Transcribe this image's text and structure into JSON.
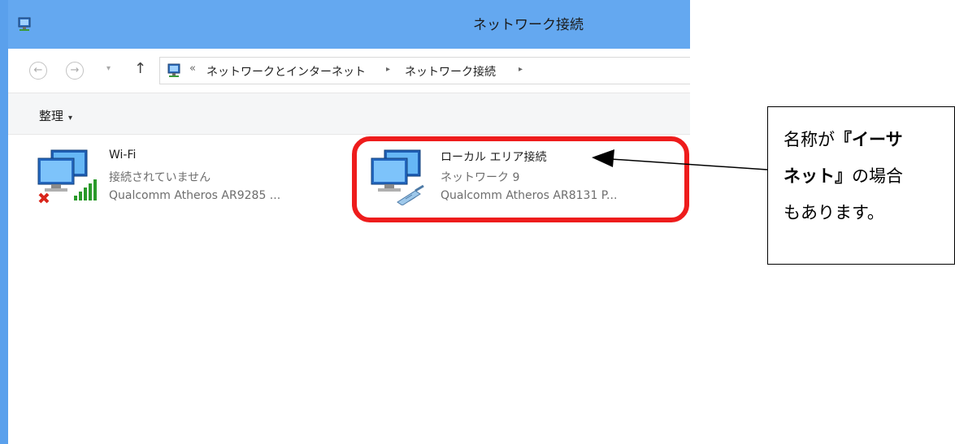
{
  "window": {
    "title": "ネットワーク接続"
  },
  "address_bar": {
    "back_label": "←",
    "forward_label": "→",
    "recent_label": "▾",
    "up_label": "↑",
    "overflow_label": "«",
    "breadcrumbs": [
      "ネットワークとインターネット",
      "ネットワーク接続"
    ],
    "separator": "▸"
  },
  "toolbar": {
    "organize_label": "整理",
    "organize_arrow": "▾"
  },
  "connections": [
    {
      "name": "Wi-Fi",
      "status": "接続されていません",
      "device": "Qualcomm Atheros AR9285 ...",
      "icon": "wifi-adapter-disconnected-icon"
    },
    {
      "name": "ローカル エリア接続",
      "status": "ネットワーク 9",
      "device": "Qualcomm Atheros AR8131 P...",
      "icon": "ethernet-adapter-icon"
    }
  ],
  "callout": {
    "line1_prefix": "名称が",
    "line1_bold": "『イーサ",
    "line2_bold": "ネット』",
    "line2_suffix": "の場合",
    "line3": "もあります。"
  },
  "colors": {
    "titlebar": "#64a8f0",
    "highlight": "#ee1c1c"
  }
}
